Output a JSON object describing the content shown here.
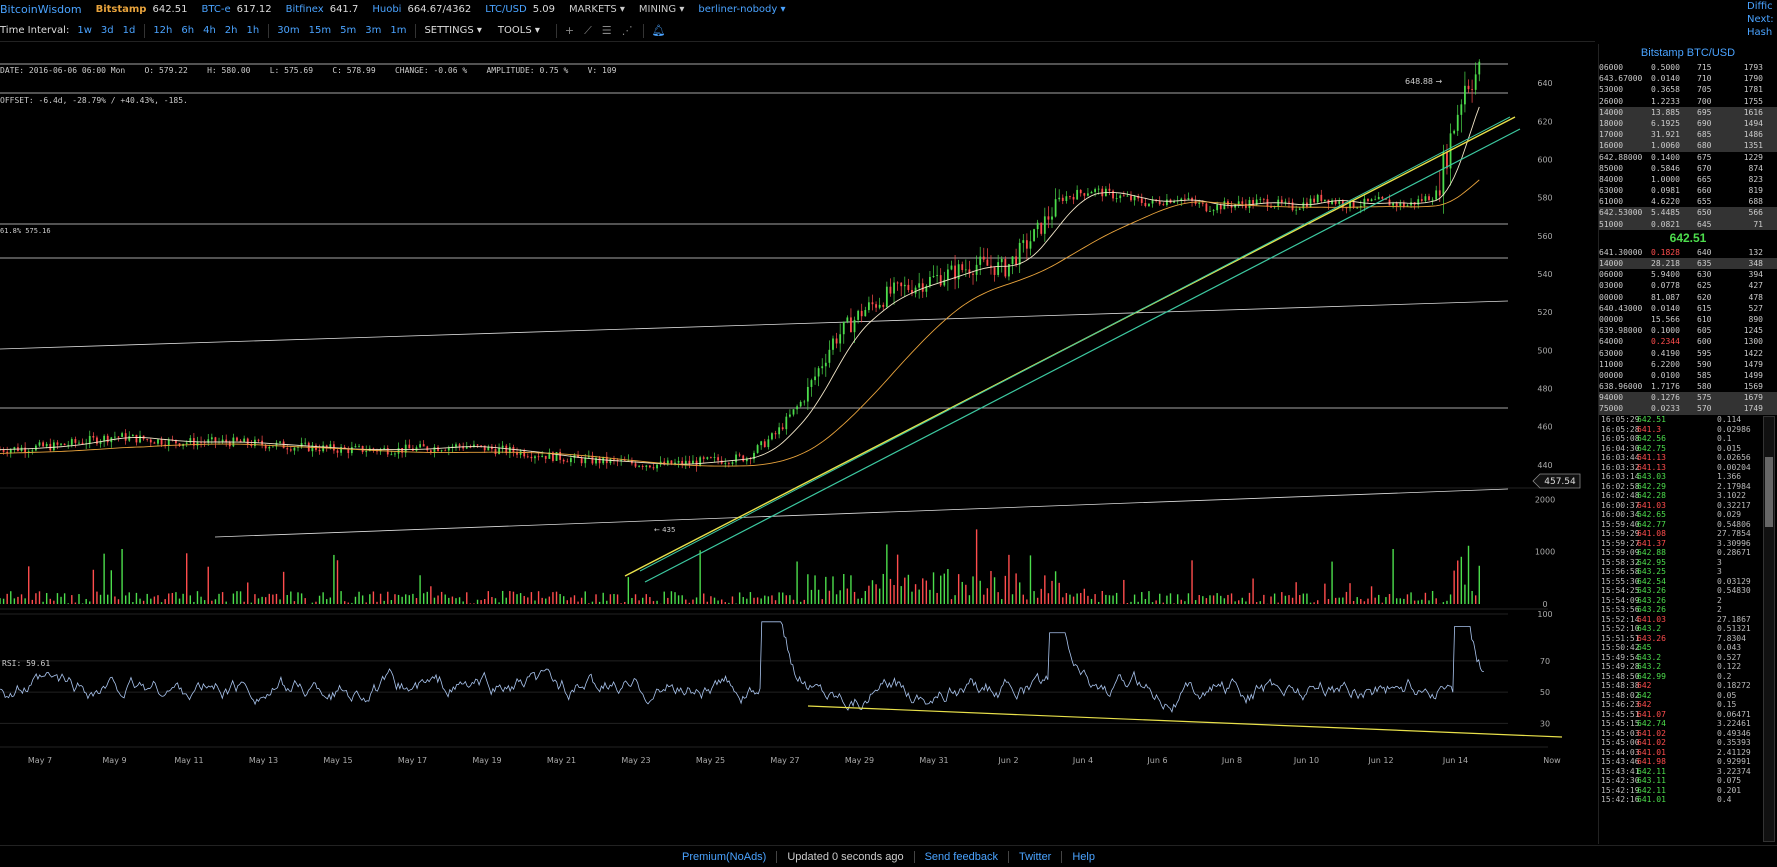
{
  "topbar": {
    "brand": "BitcoinWisdom",
    "markets": [
      {
        "name": "Bitstamp",
        "price": "642.51",
        "bold": true
      },
      {
        "name": "BTC-e",
        "price": "617.12",
        "bold": false
      },
      {
        "name": "Bitfinex",
        "price": "641.7",
        "bold": false
      },
      {
        "name": "Huobi",
        "price": "664.67/4362",
        "bold": false
      },
      {
        "name": "LTC/USD",
        "price": "5.09",
        "bold": false
      }
    ],
    "menus": [
      "MARKETS",
      "MINING"
    ],
    "user": "berliner-nobody",
    "right_links": [
      "Diffic",
      "Next:",
      "Hash"
    ]
  },
  "toolbar": {
    "label": "Time Interval:",
    "groups": [
      [
        "1w",
        "3d",
        "1d"
      ],
      [
        "12h",
        "6h",
        "4h",
        "2h",
        "1h"
      ],
      [
        "30m",
        "15m",
        "5m",
        "3m",
        "1m"
      ]
    ],
    "settings": "SETTINGS",
    "tools": "TOOLS"
  },
  "info": {
    "line1": "DATE: 2016-06-06 06:00 Mon    O: 579.22    H: 580.00    L: 575.69    C: 578.99    CHANGE: -0.06 %    AMPLITUDE: 0.75 %    V: 109",
    "line2": "OFFSET: -6.4d, -28.79% / +40.43%, -185."
  },
  "chart_data": {
    "type": "candlestick",
    "price_axis": {
      "ticks": [
        440,
        460,
        480,
        500,
        520,
        540,
        560,
        580,
        600,
        620,
        640
      ],
      "range": [
        430,
        650
      ]
    },
    "volume_axis": {
      "ticks": [
        0,
        1000,
        2000
      ]
    },
    "rsi": {
      "label": "RSI: 59.61",
      "ticks": [
        30,
        50,
        70,
        100
      ]
    },
    "x_labels": [
      "May 7",
      "May 9",
      "May 11",
      "May 13",
      "May 15",
      "May 17",
      "May 19",
      "May 21",
      "May 23",
      "May 25",
      "May 27",
      "May 29",
      "May 31",
      "Jun 2",
      "Jun 4",
      "Jun 6",
      "Jun 8",
      "Jun 10",
      "Jun 12",
      "Jun 14",
      "Now"
    ],
    "annotations": {
      "high_marker": "648.88",
      "level_label": "61.8% 575.16",
      "cursor_price": "457.54",
      "low_marker": "435"
    },
    "price_path": [
      [
        0,
        448
      ],
      [
        2,
        450
      ],
      [
        4,
        455
      ],
      [
        6,
        452
      ],
      [
        8,
        452
      ],
      [
        10,
        450
      ],
      [
        12,
        448
      ],
      [
        14,
        448
      ],
      [
        16,
        450
      ],
      [
        18,
        447
      ],
      [
        20,
        443
      ],
      [
        22,
        441
      ],
      [
        23,
        440
      ],
      [
        24,
        441
      ],
      [
        26,
        444
      ],
      [
        27,
        456
      ],
      [
        28,
        475
      ],
      [
        29,
        505
      ],
      [
        30,
        520
      ],
      [
        31,
        530
      ],
      [
        32,
        535
      ],
      [
        33,
        540
      ],
      [
        34,
        545
      ],
      [
        35,
        543
      ],
      [
        36,
        560
      ],
      [
        37,
        580
      ],
      [
        38,
        584
      ],
      [
        40,
        577
      ],
      [
        41,
        580
      ],
      [
        42,
        575
      ],
      [
        44,
        578
      ],
      [
        45,
        575
      ],
      [
        46,
        580
      ],
      [
        47,
        576
      ],
      [
        48,
        578
      ],
      [
        49,
        576
      ],
      [
        50,
        582
      ],
      [
        51,
        640
      ],
      [
        51.5,
        646
      ]
    ]
  },
  "orderbook": {
    "title": "Bitstamp BTC/USD",
    "asks": [
      [
        "06000",
        "0.5000",
        "715",
        "1793"
      ],
      [
        "643.67000",
        "0.0140",
        "710",
        "1790"
      ],
      [
        "53000",
        "0.3658",
        "705",
        "1781"
      ],
      [
        "26000",
        "1.2233",
        "700",
        "1755"
      ],
      [
        "14000",
        "13.885",
        "695",
        "1616"
      ],
      [
        "18000",
        "6.1925",
        "690",
        "1494"
      ],
      [
        "17000",
        "31.921",
        "685",
        "1486"
      ],
      [
        "16000",
        "1.0060",
        "680",
        "1351"
      ],
      [
        "642.88000",
        "0.1400",
        "675",
        "1229"
      ],
      [
        "85000",
        "0.5846",
        "670",
        "874"
      ],
      [
        "84000",
        "1.0000",
        "665",
        "823"
      ],
      [
        "63000",
        "0.0981",
        "660",
        "819"
      ],
      [
        "61000",
        "4.6220",
        "655",
        "688"
      ],
      [
        "642.53000",
        "5.4485",
        "650",
        "566"
      ],
      [
        "51000",
        "0.0821",
        "645",
        "71"
      ]
    ],
    "last": "642.51",
    "bids": [
      [
        "641.30000",
        "0.1828",
        "640",
        "132"
      ],
      [
        "14000",
        "28.218",
        "635",
        "348"
      ],
      [
        "06000",
        "5.9400",
        "630",
        "394"
      ],
      [
        "03000",
        "0.0778",
        "625",
        "427"
      ],
      [
        "00000",
        "81.087",
        "620",
        "478"
      ],
      [
        "640.43000",
        "0.0140",
        "615",
        "527"
      ],
      [
        "00000",
        "15.566",
        "610",
        "890"
      ],
      [
        "639.98000",
        "0.1000",
        "605",
        "1245"
      ],
      [
        "64000",
        "0.2344",
        "600",
        "1300"
      ],
      [
        "63000",
        "0.4190",
        "595",
        "1422"
      ],
      [
        "11000",
        "6.2200",
        "590",
        "1479"
      ],
      [
        "00000",
        "0.0100",
        "585",
        "1499"
      ],
      [
        "638.96000",
        "1.7176",
        "580",
        "1569"
      ],
      [
        "94000",
        "0.1276",
        "575",
        "1679"
      ],
      [
        "75000",
        "0.0233",
        "570",
        "1749"
      ]
    ]
  },
  "trades": [
    [
      "16:05:29",
      "642.51",
      "0.114",
      "up"
    ],
    [
      "16:05:28",
      "641.3",
      "0.02986",
      "dn"
    ],
    [
      "16:05:08",
      "642.56",
      "0.1",
      "up"
    ],
    [
      "16:04:30",
      "642.75",
      "0.015",
      "up"
    ],
    [
      "16:03:44",
      "641.13",
      "0.02656",
      "dn"
    ],
    [
      "16:03:32",
      "641.13",
      "0.00204",
      "dn"
    ],
    [
      "16:03:14",
      "643.03",
      "1.366",
      "up"
    ],
    [
      "16:02:58",
      "642.29",
      "2.17984",
      "up"
    ],
    [
      "16:02:48",
      "642.28",
      "3.1022",
      "up"
    ],
    [
      "16:00:37",
      "641.03",
      "0.32217",
      "dn"
    ],
    [
      "16:00:34",
      "642.65",
      "0.029",
      "up"
    ],
    [
      "15:59:40",
      "642.77",
      "0.54806",
      "up"
    ],
    [
      "15:59:29",
      "641.08",
      "27.7854",
      "dn"
    ],
    [
      "15:59:27",
      "641.37",
      "3.30996",
      "dn"
    ],
    [
      "15:59:09",
      "642.88",
      "0.28671",
      "up"
    ],
    [
      "15:58:32",
      "642.95",
      "3",
      "up"
    ],
    [
      "15:56:58",
      "643.25",
      "3",
      "up"
    ],
    [
      "15:55:30",
      "642.54",
      "0.03129",
      "up"
    ],
    [
      "15:54:25",
      "643.26",
      "0.54830",
      "up"
    ],
    [
      "15:54:09",
      "643.26",
      "2",
      "up"
    ],
    [
      "15:53:56",
      "643.26",
      "2",
      "up"
    ],
    [
      "15:52:14",
      "641.03",
      "27.1867",
      "dn"
    ],
    [
      "15:52:10",
      "643.2",
      "0.51321",
      "up"
    ],
    [
      "15:51:51",
      "643.26",
      "7.8304",
      "dn"
    ],
    [
      "15:50:42",
      "645",
      "0.043",
      "up"
    ],
    [
      "15:49:54",
      "643.2",
      "0.527",
      "up"
    ],
    [
      "15:49:28",
      "643.2",
      "0.122",
      "up"
    ],
    [
      "15:48:50",
      "642.99",
      "0.2",
      "up"
    ],
    [
      "15:48:38",
      "642",
      "0.18272",
      "dn"
    ],
    [
      "15:48:02",
      "642",
      "0.05",
      "up"
    ],
    [
      "15:46:23",
      "642",
      "0.15",
      "dn"
    ],
    [
      "15:45:51",
      "641.07",
      "0.06471",
      "dn"
    ],
    [
      "15:45:15",
      "642.74",
      "3.22461",
      "up"
    ],
    [
      "15:45:03",
      "641.02",
      "0.49346",
      "dn"
    ],
    [
      "15:45:00",
      "641.02",
      "0.35393",
      "dn"
    ],
    [
      "15:44:03",
      "641.01",
      "2.41129",
      "dn"
    ],
    [
      "15:43:46",
      "641.98",
      "0.92991",
      "dn"
    ],
    [
      "15:43:41",
      "642.11",
      "3.22374",
      "up"
    ],
    [
      "15:42:30",
      "643.11",
      "0.075",
      "up"
    ],
    [
      "15:42:19",
      "642.11",
      "0.201",
      "up"
    ],
    [
      "15:42:16",
      "641.01",
      "0.4",
      "up"
    ]
  ],
  "footer": {
    "premium": "Premium(NoAds)",
    "status": "Updated 0 seconds ago",
    "links": [
      "Send feedback",
      "Twitter",
      "Help"
    ]
  },
  "colors": {
    "accent": "#4aa3ff",
    "bitstamp": "#e8a33c",
    "up": "#4cdd4c",
    "down": "#ff4d4d",
    "trendline": "#e8e04a",
    "channel": "#3cc8a0",
    "rsi_line": "#a9c4ee"
  }
}
